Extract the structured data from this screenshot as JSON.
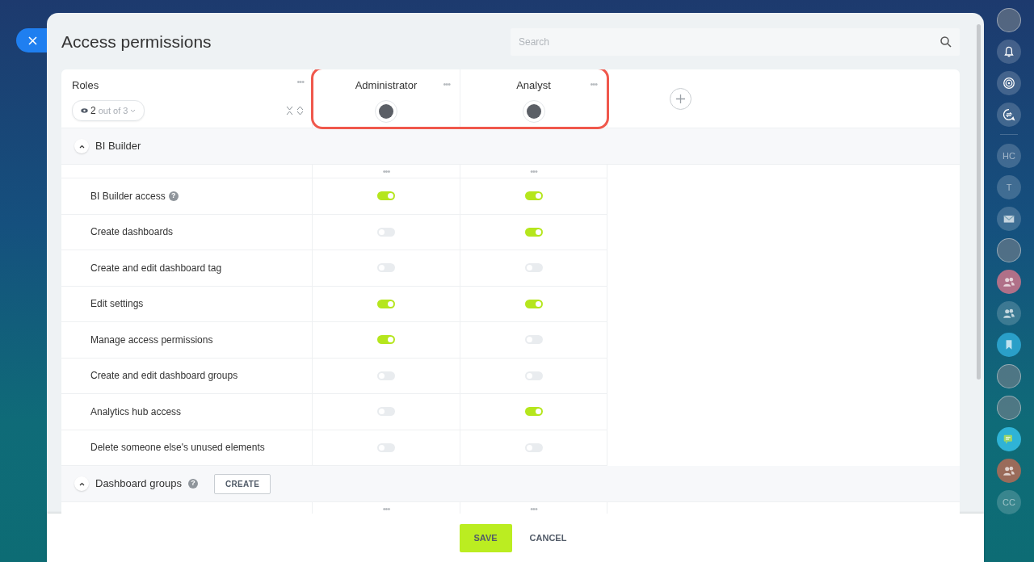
{
  "title": "Access permissions",
  "search": {
    "placeholder": "Search"
  },
  "roles_header": {
    "label": "Roles",
    "menu": "•••",
    "filter_count": "2",
    "filter_total": "out of 3"
  },
  "role_columns": [
    {
      "name": "Administrator",
      "menu": "•••"
    },
    {
      "name": "Analyst",
      "menu": "•••"
    }
  ],
  "sections": [
    {
      "title": "BI Builder",
      "expanded": true,
      "column_menus": [
        "•••",
        "•••"
      ],
      "permissions": [
        {
          "label": "BI Builder access",
          "help": "?",
          "values": [
            true,
            true
          ]
        },
        {
          "label": "Create dashboards",
          "values": [
            false,
            true
          ]
        },
        {
          "label": "Create and edit dashboard tag",
          "values": [
            false,
            false
          ]
        },
        {
          "label": "Edit settings",
          "values": [
            true,
            true
          ]
        },
        {
          "label": "Manage access permissions",
          "values": [
            true,
            false
          ]
        },
        {
          "label": "Create and edit dashboard groups",
          "values": [
            false,
            false
          ]
        },
        {
          "label": "Analytics hub access",
          "values": [
            false,
            true
          ]
        },
        {
          "label": "Delete someone else's unused elements",
          "values": [
            false,
            false
          ]
        }
      ]
    },
    {
      "title": "Dashboard groups",
      "expanded": true,
      "help": "?",
      "create_button": "CREATE",
      "column_menus": [
        "•••",
        "•••"
      ]
    }
  ],
  "footer": {
    "save": "SAVE",
    "cancel": "CANCEL"
  },
  "right_sidebar": [
    {
      "kind": "avatar"
    },
    {
      "kind": "bell"
    },
    {
      "kind": "target"
    },
    {
      "kind": "chat-arrows"
    },
    {
      "kind": "divider"
    },
    {
      "kind": "text",
      "text": "HC"
    },
    {
      "kind": "text",
      "text": "T"
    },
    {
      "kind": "mail"
    },
    {
      "kind": "avatar"
    },
    {
      "kind": "group",
      "color": "#b07088"
    },
    {
      "kind": "group"
    },
    {
      "kind": "bookmark",
      "color": "#2a9fc8"
    },
    {
      "kind": "avatar"
    },
    {
      "kind": "avatar"
    },
    {
      "kind": "chat",
      "color": "#2fb3d6"
    },
    {
      "kind": "group",
      "color": "#9a6b5a"
    },
    {
      "kind": "text",
      "text": "CC"
    }
  ]
}
